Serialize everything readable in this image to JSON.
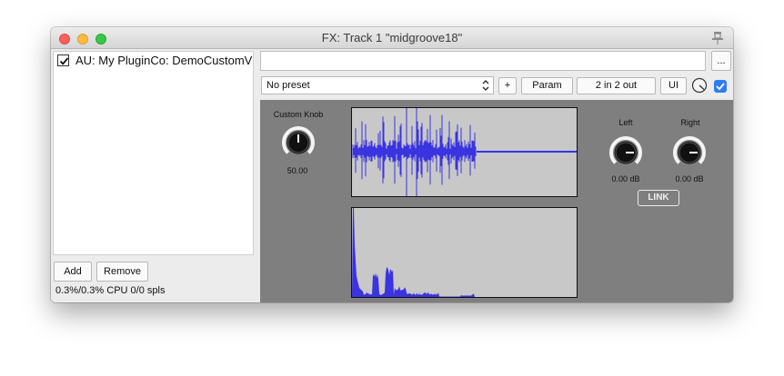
{
  "window": {
    "title": "FX: Track 1 \"midgroove18\""
  },
  "fx_list": {
    "items": [
      {
        "label": "AU: My PluginCo: DemoCustomView",
        "enabled": true
      }
    ]
  },
  "buttons": {
    "add": "Add",
    "remove": "Remove",
    "ellipsis": "...",
    "plus": "+",
    "param": "Param",
    "io": "2 in 2 out",
    "ui": "UI"
  },
  "cpu_status": "0.3%/0.3% CPU 0/0 spls",
  "preset": {
    "selected": "No preset"
  },
  "plugin": {
    "custom_knob": {
      "label": "Custom Knob",
      "value": "50.00"
    },
    "left": {
      "label": "Left",
      "value": "0.00 dB"
    },
    "right": {
      "label": "Right",
      "value": "0.00 dB"
    },
    "link": "LINK",
    "colors": {
      "waveform": "#3a33e0",
      "panel": "#7f7f7f",
      "display_bg": "#c8c8c8"
    }
  },
  "icons": [
    "close-icon",
    "minimize-icon",
    "maximize-icon",
    "pin-icon",
    "checkbox-checked-icon",
    "updown-arrows-icon",
    "knob-icon"
  ]
}
